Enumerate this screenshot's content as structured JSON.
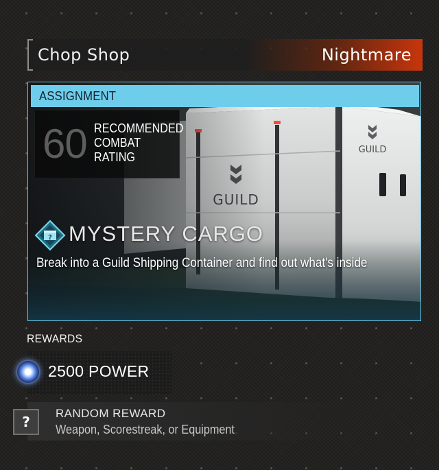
{
  "header": {
    "map_name": "Chop Shop",
    "difficulty": "Nightmare"
  },
  "assignment": {
    "header_label": "ASSIGNMENT",
    "recommended_rating": "60",
    "recommended_label": "RECOMMENDED\nCOMBAT\nRATING",
    "title": "MYSTERY CARGO",
    "description": "Break into a Guild Shipping Container and find out what's inside",
    "icon": "mystery-cargo-icon",
    "background_image_text": [
      "GUILD",
      "GUILD"
    ]
  },
  "rewards": {
    "heading": "REWARDS",
    "power": {
      "label": "2500 POWER",
      "icon": "power-orb-icon"
    },
    "random": {
      "icon_glyph": "?",
      "title": "RANDOM REWARD",
      "description": "Weapon, Scorestreak, or Equipment"
    }
  },
  "colors": {
    "accent_cyan": "#6fcdec",
    "difficulty_orange": "#c8350c",
    "background": "#262523"
  }
}
